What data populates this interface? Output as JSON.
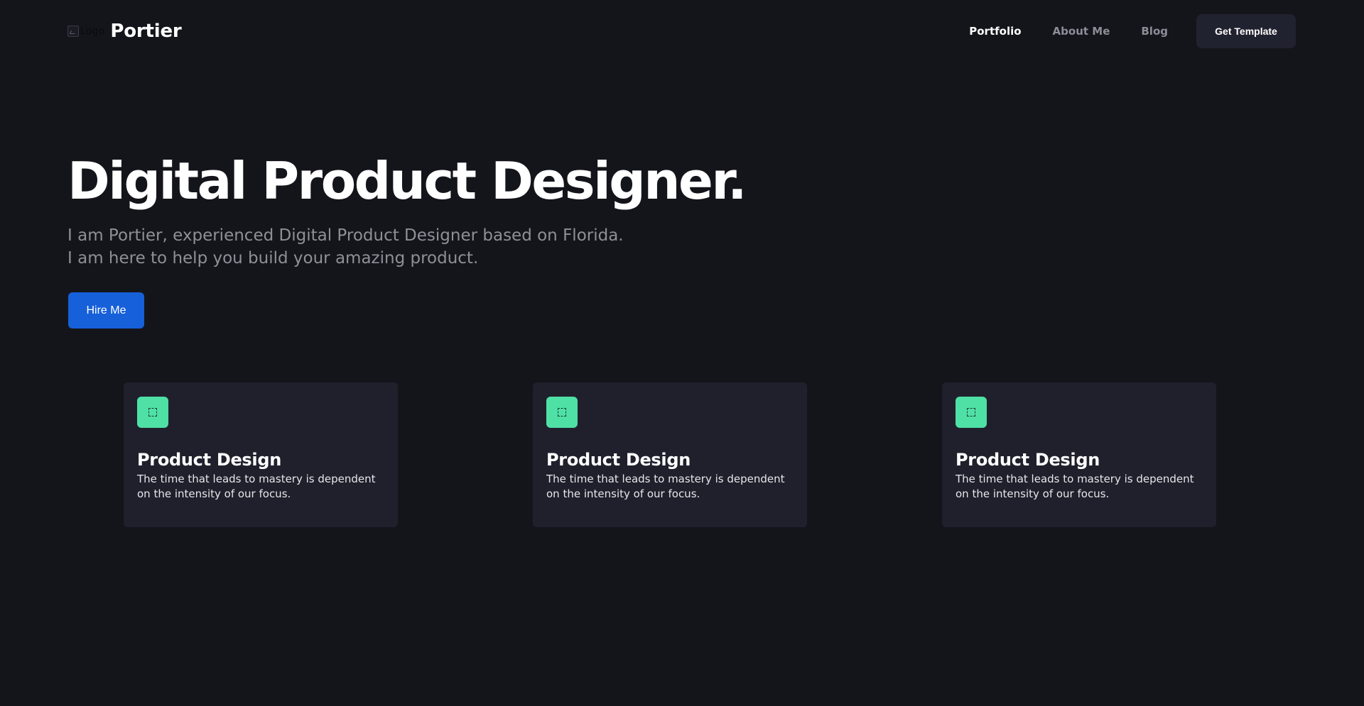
{
  "header": {
    "logo_alt": "Logo",
    "brand": "Portier",
    "nav": [
      {
        "label": "Portfolio",
        "active": true
      },
      {
        "label": "About Me",
        "active": false
      },
      {
        "label": "Blog",
        "active": false
      }
    ],
    "cta_label": "Get Template"
  },
  "hero": {
    "title": "Digital Product Designer.",
    "subtitle_line1": "I am Portier, experienced Digital Product Designer based on Florida.",
    "subtitle_line2": "I am here to help you build your amazing product.",
    "button_label": "Hire Me"
  },
  "cards": [
    {
      "icon": "selection-icon",
      "title": "Product Design",
      "text": "The time that leads to mastery is dependent on the intensity of our focus."
    },
    {
      "icon": "selection-icon",
      "title": "Product Design",
      "text": "The time that leads to mastery is dependent on the intensity of our focus."
    },
    {
      "icon": "selection-icon",
      "title": "Product Design",
      "text": "The time that leads to mastery is dependent on the intensity of our focus."
    }
  ],
  "colors": {
    "background": "#14151b",
    "card_background": "#20202d",
    "accent_blue": "#1660d9",
    "icon_green": "#4fe0a5",
    "muted_text": "#8f9097"
  }
}
